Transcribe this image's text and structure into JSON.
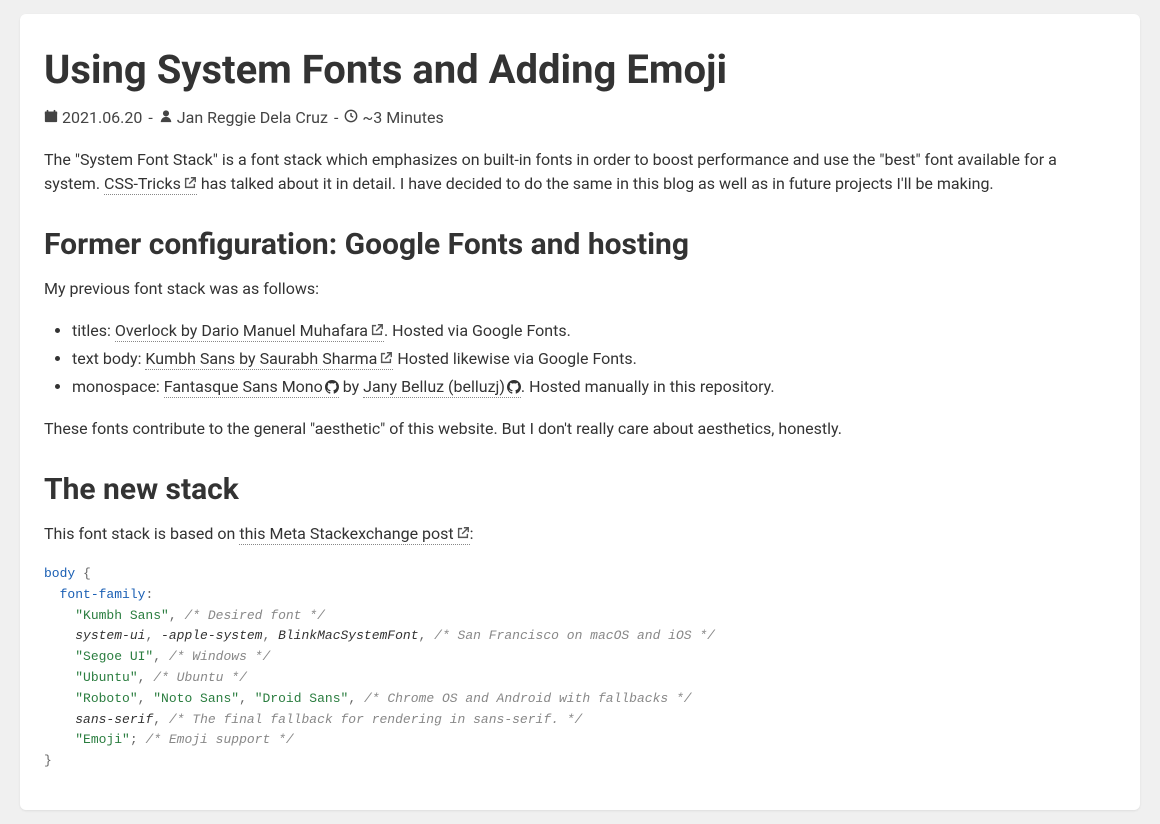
{
  "post": {
    "title": "Using System Fonts and Adding Emoji",
    "date": "2021.06.20",
    "author": "Jan Reggie Dela Cruz",
    "readtime": "~3 Minutes",
    "sep": " - "
  },
  "intro": {
    "before": "The \"System Font Stack\" is a font stack which emphasizes on built-in fonts in order to boost performance and use the \"best\" font available for a system. ",
    "link": "CSS-Tricks",
    "after": " has talked about it in detail. I have decided to do the same in this blog as well as in future projects I'll be making."
  },
  "section1": {
    "heading": "Former configuration: Google Fonts and hosting",
    "lead": "My previous font stack was as follows:",
    "items": [
      {
        "label": "titles: ",
        "link": "Overlock by Dario Manuel Muhafara",
        "ext": true,
        "after": ". Hosted via Google Fonts."
      },
      {
        "label": "text body: ",
        "link": "Kumbh Sans by Saurabh Sharma",
        "ext": true,
        "after": " Hosted likewise via Google Fonts."
      },
      {
        "label": "monospace: ",
        "link1": "Fantasque Sans Mono",
        "gh1": true,
        "mid": " by ",
        "link2": "Jany Belluz (belluzj)",
        "gh2": true,
        "after": ". Hosted manually in this repository."
      }
    ],
    "closing": "These fonts contribute to the general \"aesthetic\" of this website. But I don't really care about aesthetics, honestly."
  },
  "section2": {
    "heading": "The new stack",
    "lead_before": "This font stack is based on ",
    "lead_link": "this Meta Stackexchange post",
    "lead_after": ":"
  },
  "code": {
    "selector": "body",
    "brace_open": " {",
    "prop": "font-family",
    "colon": ":",
    "lines": [
      {
        "tokens": [
          [
            "str",
            "\"Kumbh Sans\""
          ],
          [
            "punc",
            ","
          ]
        ],
        "comment": "/* Desired font */"
      },
      {
        "tokens": [
          [
            "id",
            "system-ui"
          ],
          [
            "punc",
            ","
          ],
          [
            "id",
            " -apple-system"
          ],
          [
            "punc",
            ","
          ],
          [
            "id",
            " BlinkMacSystemFont"
          ],
          [
            "punc",
            ","
          ]
        ],
        "comment": "/* San Francisco on macOS and iOS */"
      },
      {
        "tokens": [
          [
            "str",
            "\"Segoe UI\""
          ],
          [
            "punc",
            ","
          ]
        ],
        "comment": "/* Windows */"
      },
      {
        "tokens": [
          [
            "str",
            "\"Ubuntu\""
          ],
          [
            "punc",
            ","
          ]
        ],
        "comment": "/* Ubuntu */"
      },
      {
        "tokens": [
          [
            "str",
            "\"Roboto\""
          ],
          [
            "punc",
            ","
          ],
          [
            "str",
            " \"Noto Sans\""
          ],
          [
            "punc",
            ","
          ],
          [
            "str",
            " \"Droid Sans\""
          ],
          [
            "punc",
            ","
          ]
        ],
        "comment": "/* Chrome OS and Android with fallbacks */"
      },
      {
        "tokens": [
          [
            "id",
            "sans-serif"
          ],
          [
            "punc",
            ","
          ]
        ],
        "comment": "/* The final fallback for rendering in sans-serif. */"
      },
      {
        "tokens": [
          [
            "str",
            "\"Emoji\""
          ],
          [
            "punc",
            ";"
          ]
        ],
        "comment": "/* Emoji support */"
      }
    ],
    "brace_close": "}"
  }
}
